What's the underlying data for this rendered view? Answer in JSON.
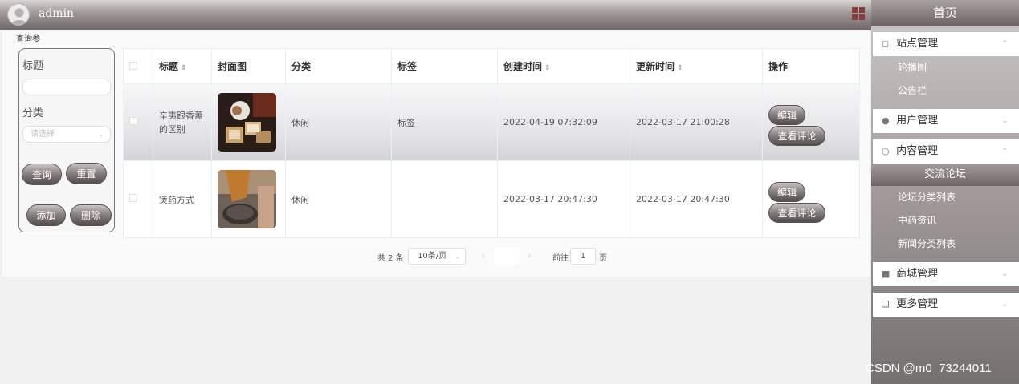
{
  "header": {
    "username": "admin",
    "avatar_icon": "user-avatar-icon",
    "menu_icon": "grid-menu-icon"
  },
  "sidebar": {
    "home": "首页",
    "groups": [
      {
        "label": "站点管理",
        "icon": "monitor-icon",
        "items": [
          "轮播图",
          "公告栏"
        ]
      },
      {
        "label": "用户管理",
        "icon": "user-icon",
        "items": []
      },
      {
        "label": "内容管理",
        "icon": "chat-icon",
        "items": [
          "交流论坛",
          "论坛分类列表",
          "中药资讯",
          "新闻分类列表"
        ],
        "active": "交流论坛"
      },
      {
        "label": "商城管理",
        "icon": "bag-icon",
        "items": []
      },
      {
        "label": "更多管理",
        "icon": "copy-icon",
        "items": []
      }
    ]
  },
  "search": {
    "section_label": "查询参",
    "title_label": "标题",
    "title_value": "",
    "category_label": "分类",
    "category_placeholder": "请选择",
    "buttons": {
      "query": "查询",
      "reset": "重置",
      "add": "添加",
      "delete": "删除"
    }
  },
  "table": {
    "columns": [
      "",
      "标题",
      "封面图",
      "分类",
      "标签",
      "创建时间",
      "更新时间",
      "操作"
    ],
    "rows": [
      {
        "title": "辛夷跟香薷的区别",
        "category": "休闲",
        "tag": "标签",
        "created": "2022-04-19 07:32:09",
        "updated": "2022-03-17 21:00:28"
      },
      {
        "title": "煲药方式",
        "category": "休闲",
        "tag": "",
        "created": "2022-03-17 20:47:30",
        "updated": "2022-03-17 20:47:30"
      }
    ],
    "actions": {
      "edit": "编辑",
      "view_comments": "查看评论"
    }
  },
  "pagination": {
    "total": "共 2 条",
    "page_size": "10条/页",
    "goto": "前往",
    "page": "1",
    "page_unit": "页"
  },
  "watermark": "CSDN @m0_73244011"
}
